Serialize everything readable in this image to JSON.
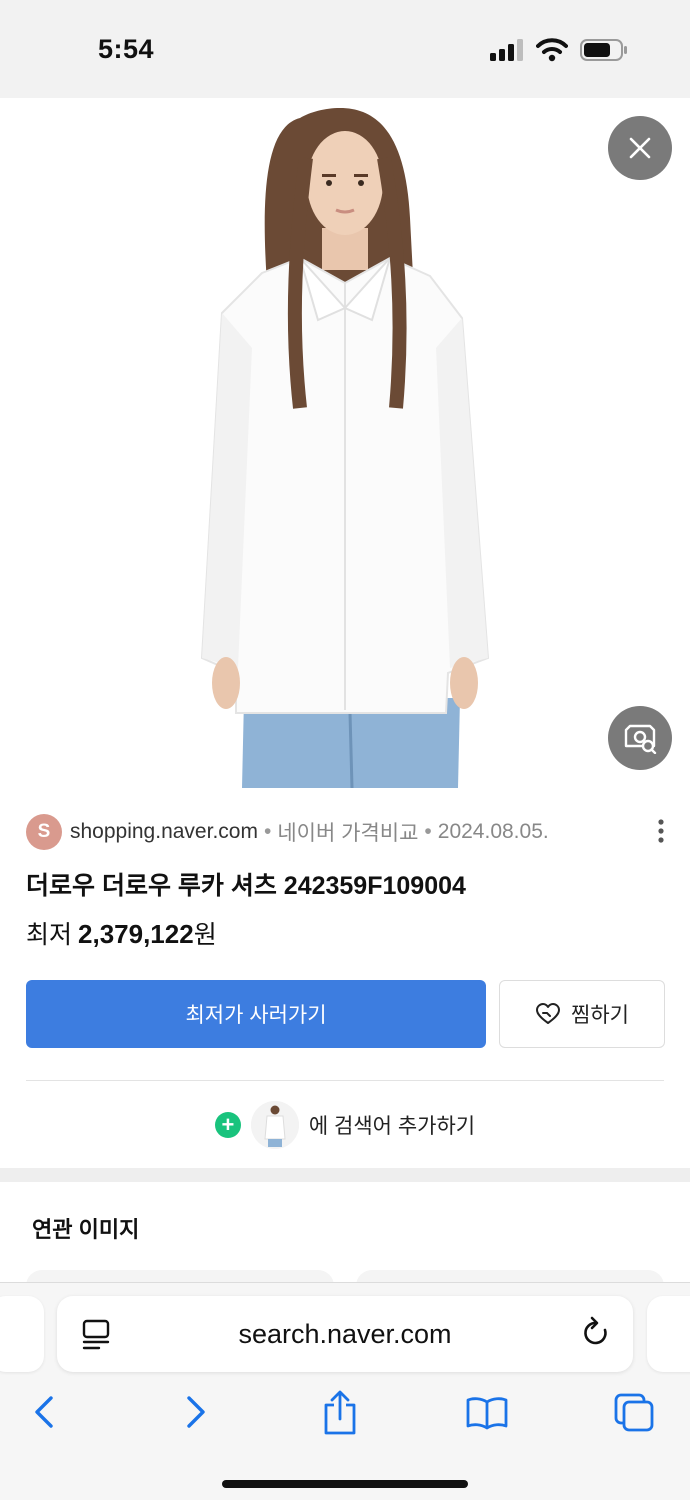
{
  "status_bar": {
    "time": "5:54"
  },
  "source": {
    "avatar_letter": "S",
    "domain": "shopping.naver.com",
    "separator": "•",
    "provider": "네이버 가격비교",
    "date": "2024.08.05."
  },
  "product": {
    "title": "더로우 더로우 루카 셔츠 242359F109004",
    "price_label": "최저",
    "price_value": "2,379,122",
    "price_unit": "원"
  },
  "actions": {
    "buy_label": "최저가 사러가기",
    "wish_label": "찜하기"
  },
  "add_keyword": {
    "plus": "+",
    "label": "에 검색어 추가하기"
  },
  "related": {
    "title": "연관 이미지"
  },
  "browser": {
    "url": "search.naver.com"
  },
  "colors": {
    "accent": "#3d7de0",
    "plus_green": "#19c37d",
    "avatar": "#d99a8e",
    "ios_blue": "#1a73e8"
  }
}
